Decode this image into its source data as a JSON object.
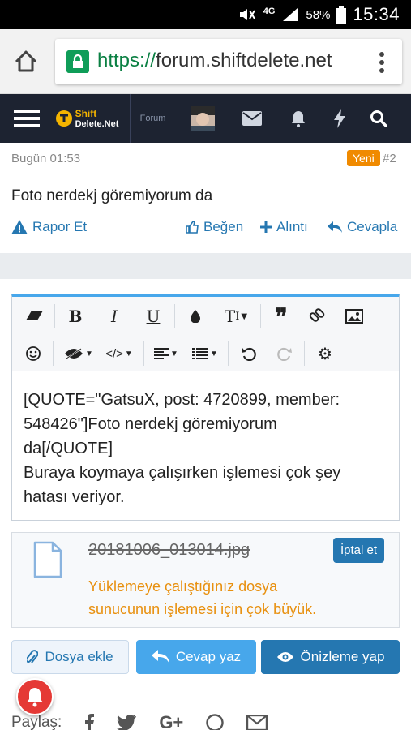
{
  "status_bar": {
    "network": "4G",
    "battery": "58%",
    "time": "15:34"
  },
  "browser": {
    "url_protocol": "https://",
    "url_host": "forum.shiftdelete.net"
  },
  "navbar": {
    "logo_line1": "Shift",
    "logo_line2": "Delete.Net",
    "section": "Forum"
  },
  "post": {
    "time": "Bugün 01:53",
    "badge": "Yeni",
    "number": "#2",
    "body": "Foto nerdekj göremiyorum da",
    "actions": {
      "report": "Rapor Et",
      "like": "Beğen",
      "quote": "Alıntı",
      "reply": "Cevapla"
    }
  },
  "editor": {
    "toolbar_row1": [
      "eraser-icon",
      "bold-icon",
      "italic-icon",
      "underline-icon",
      "color-icon",
      "text-size-icon",
      "quote-icon",
      "link-icon",
      "image-icon"
    ],
    "toolbar_row2": [
      "smilie-icon",
      "spoiler-icon",
      "code-icon",
      "align-icon",
      "list-icon",
      "undo-icon",
      "redo-icon",
      "settings-icon"
    ],
    "line1": "[QUOTE=\"GatsuX, post: 4720899, member:",
    "line2": "548426\"]Foto nerdekj göremiyorum",
    "line3": "da[/QUOTE]",
    "line4": "Buraya koymaya çalışırken işlemesi çok şey",
    "line5": "hatası veriyor."
  },
  "attachment": {
    "filename": "20181006_013014.jpg",
    "cancel_label": "İptal et",
    "error_line1": "Yüklemeye çalıştığınız dosya",
    "error_line2": "sunucunun işlemesi için çok büyük."
  },
  "buttons": {
    "attach": "Dosya ekle",
    "reply": "Cevap yaz",
    "preview": "Önizleme yap"
  },
  "share": {
    "label": "Paylaş:"
  },
  "colors": {
    "accent": "#2577b1",
    "accent_light": "#47a7eb",
    "navbar": "#1d2331",
    "badge": "#f08a00",
    "error": "#e8900e"
  }
}
